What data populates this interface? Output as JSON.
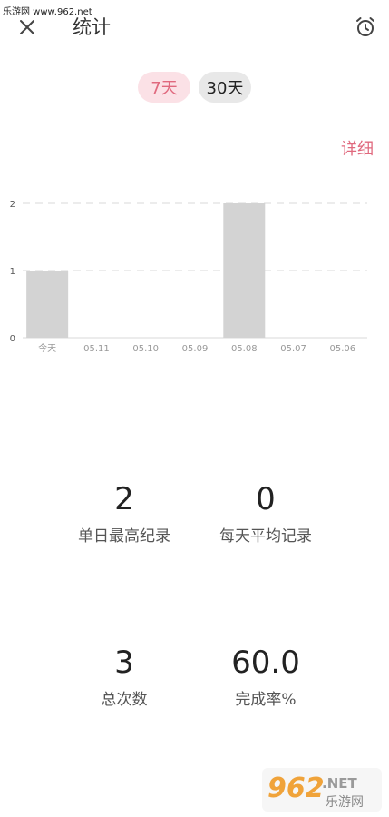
{
  "watermark": {
    "top_text": "乐游网 www.962.net",
    "bottom_main": "962",
    "bottom_net": ".NET",
    "bottom_sub": "乐游网"
  },
  "header": {
    "title": "统计",
    "close_icon": "close-icon",
    "alarm_icon": "alarm-clock-icon"
  },
  "period_tabs": [
    {
      "label": "7天",
      "active": true
    },
    {
      "label": "30天",
      "active": false
    }
  ],
  "detail_label": "详细",
  "colors": {
    "accent": "#e0697e",
    "accent_bg": "#fbe1e6",
    "bar": "#d3d3d3",
    "tab_bg": "#e8e8e8"
  },
  "chart_data": {
    "type": "bar",
    "categories": [
      "今天",
      "05.11",
      "05.10",
      "05.09",
      "05.08",
      "05.07",
      "05.06"
    ],
    "values": [
      1,
      0,
      0,
      0,
      2,
      0,
      0
    ],
    "y_ticks": [
      "0",
      "1",
      "2"
    ],
    "ylim": [
      0,
      2
    ],
    "grid": true
  },
  "stats": {
    "max_daily": {
      "value": "2",
      "label": "单日最高纪录"
    },
    "daily_avg": {
      "value": "0",
      "label": "每天平均记录"
    },
    "total": {
      "value": "3",
      "label": "总次数"
    },
    "completion": {
      "value": "60.0",
      "label": "完成率%"
    }
  }
}
